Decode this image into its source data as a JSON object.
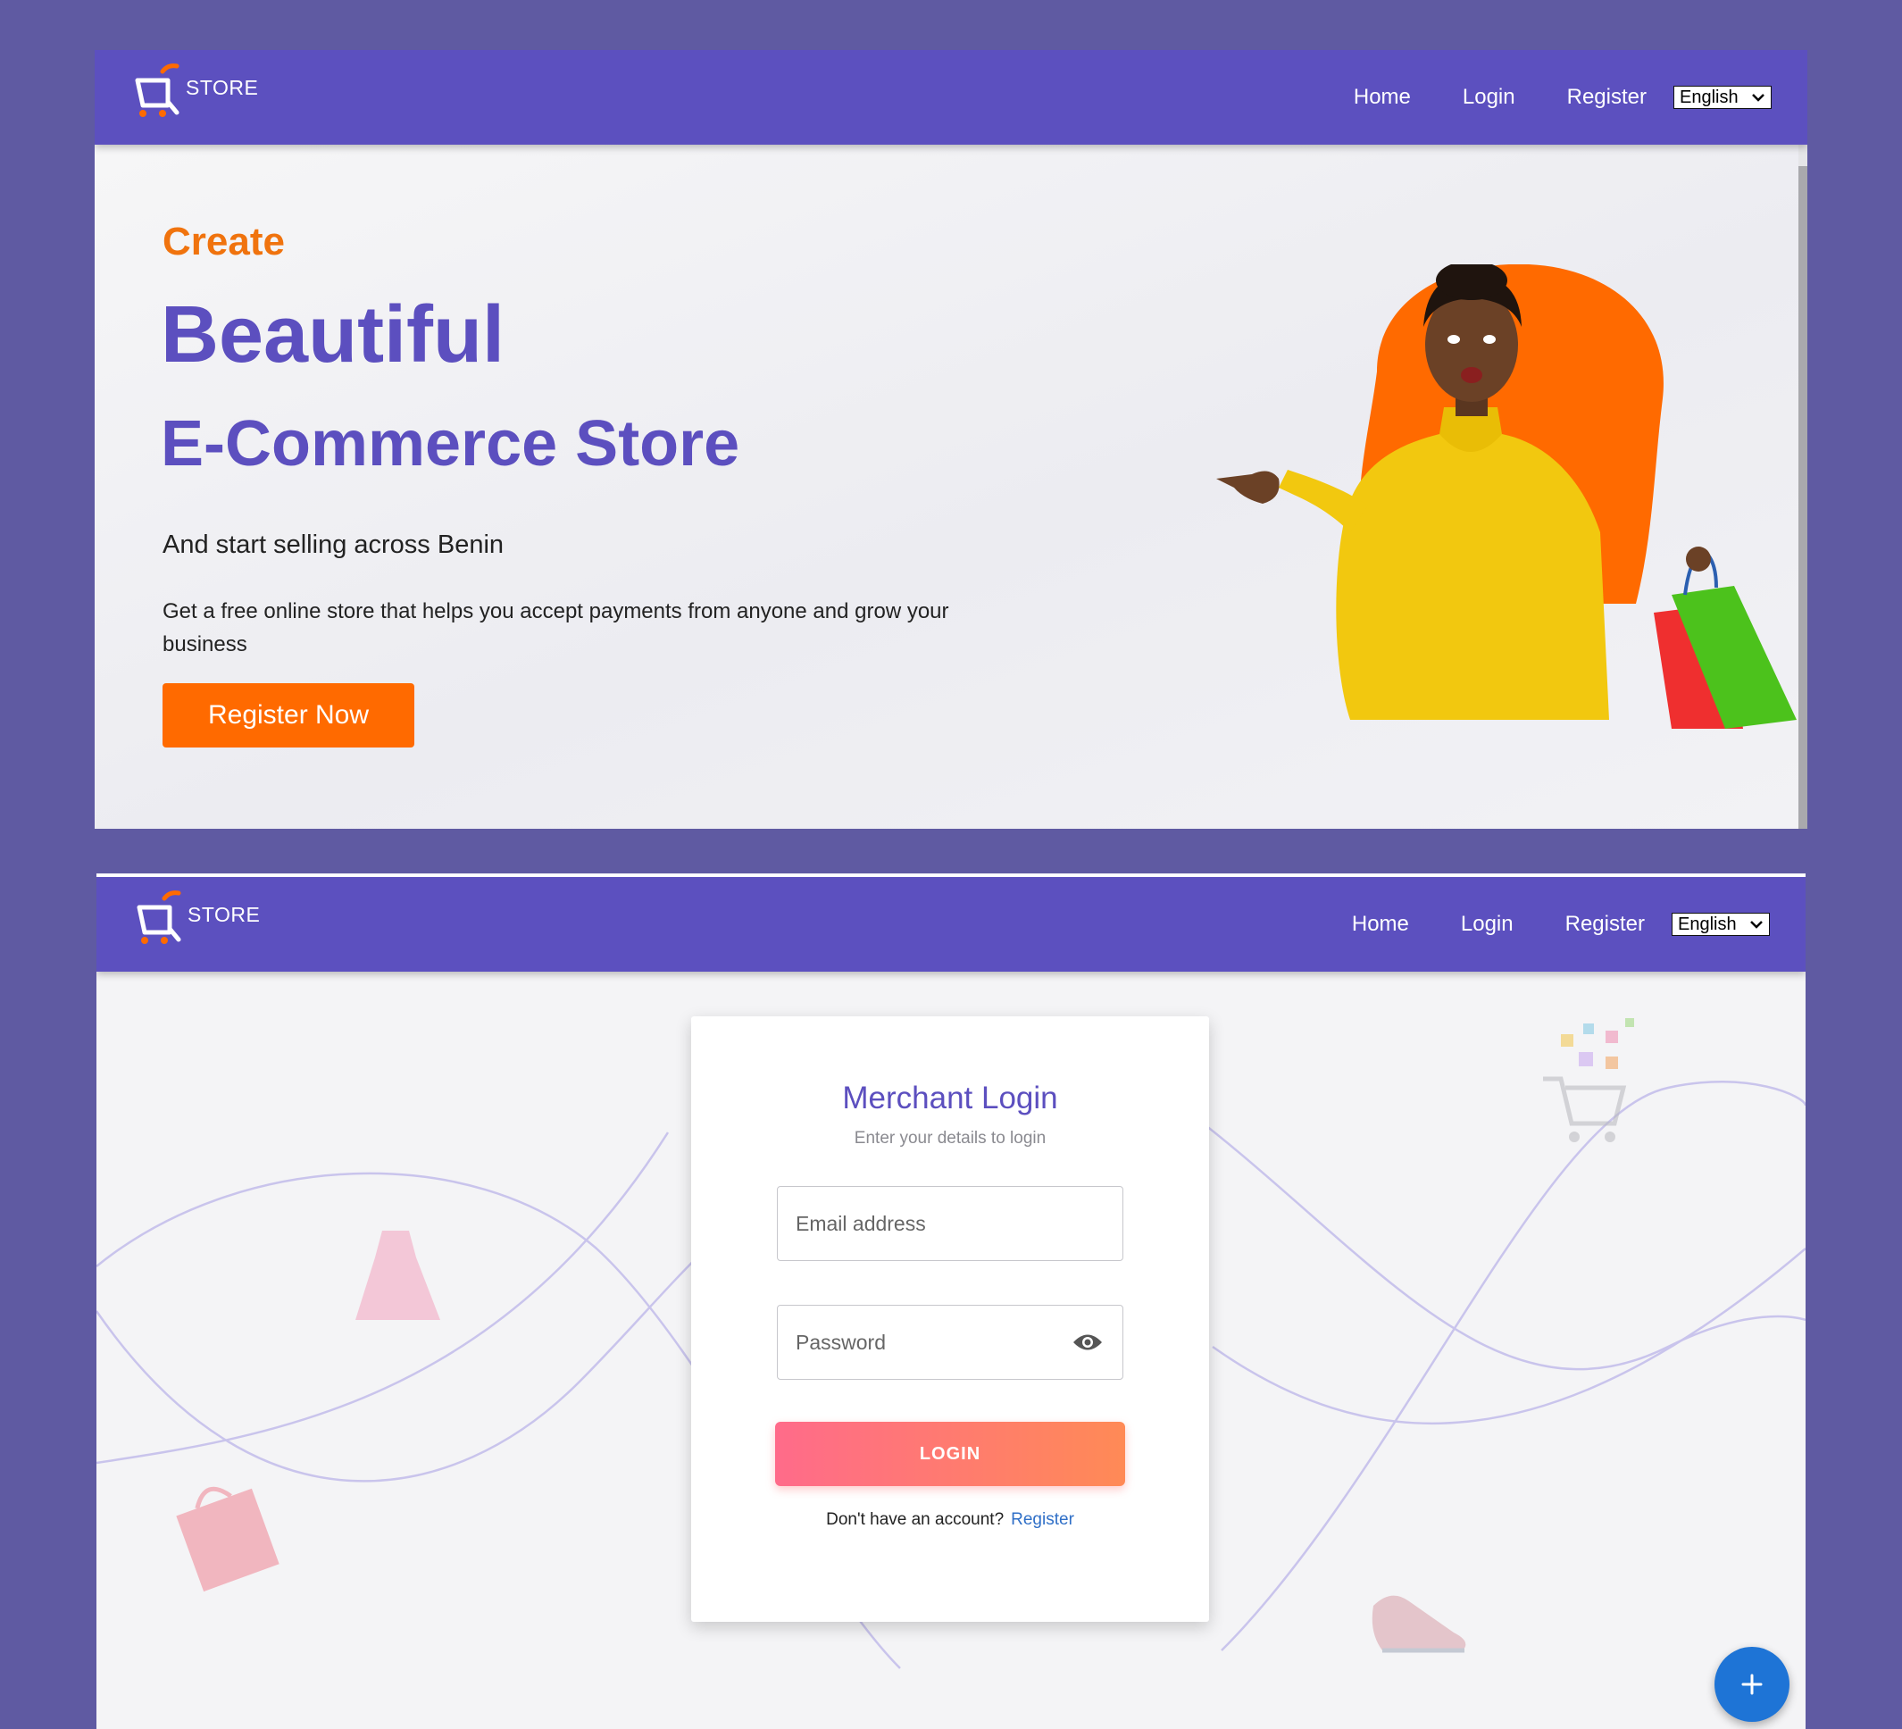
{
  "brand": {
    "logo_text": "STORE"
  },
  "nav": {
    "home": "Home",
    "login": "Login",
    "register": "Register",
    "language": "English"
  },
  "hero": {
    "create": "Create",
    "headline1": "Beautiful",
    "headline2": "E-Commerce Store",
    "subtitle": "And start selling across Benin",
    "description": "Get a free online store that helps you accept payments from anyone and grow your business",
    "cta": "Register Now"
  },
  "login": {
    "title": "Merchant Login",
    "subtitle": "Enter your details to login",
    "email_placeholder": "Email address",
    "password_placeholder": "Password",
    "button": "LOGIN",
    "no_account": "Don't have an account?",
    "register_link": "Register"
  },
  "fab": {
    "icon": "plus-icon"
  },
  "colors": {
    "primary": "#5c50bf",
    "accent": "#ff6a00",
    "page_bg": "#5f5aa2",
    "fab": "#1e74d6"
  }
}
